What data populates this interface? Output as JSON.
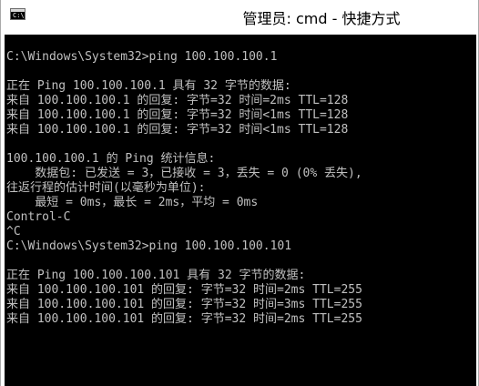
{
  "window": {
    "title": "管理员: cmd - 快捷方式",
    "icon_text": "C:\\"
  },
  "console": {
    "lines": [
      "C:\\Windows\\System32>ping 100.100.100.1",
      "",
      "正在 Ping 100.100.100.1 具有 32 字节的数据:",
      "来自 100.100.100.1 的回复: 字节=32 时间=2ms TTL=128",
      "来自 100.100.100.1 的回复: 字节=32 时间<1ms TTL=128",
      "来自 100.100.100.1 的回复: 字节=32 时间<1ms TTL=128",
      "",
      "100.100.100.1 的 Ping 统计信息:",
      "    数据包: 已发送 = 3，已接收 = 3，丢失 = 0 (0% 丢失),",
      "往返行程的估计时间(以毫秒为单位):",
      "    最短 = 0ms，最长 = 2ms，平均 = 0ms",
      "Control-C",
      "^C",
      "C:\\Windows\\System32>ping 100.100.100.101",
      "",
      "正在 Ping 100.100.100.101 具有 32 字节的数据:",
      "来自 100.100.100.101 的回复: 字节=32 时间=2ms TTL=255",
      "来自 100.100.100.101 的回复: 字节=32 时间=3ms TTL=255",
      "来自 100.100.100.101 的回复: 字节=32 时间=2ms TTL=255"
    ]
  }
}
